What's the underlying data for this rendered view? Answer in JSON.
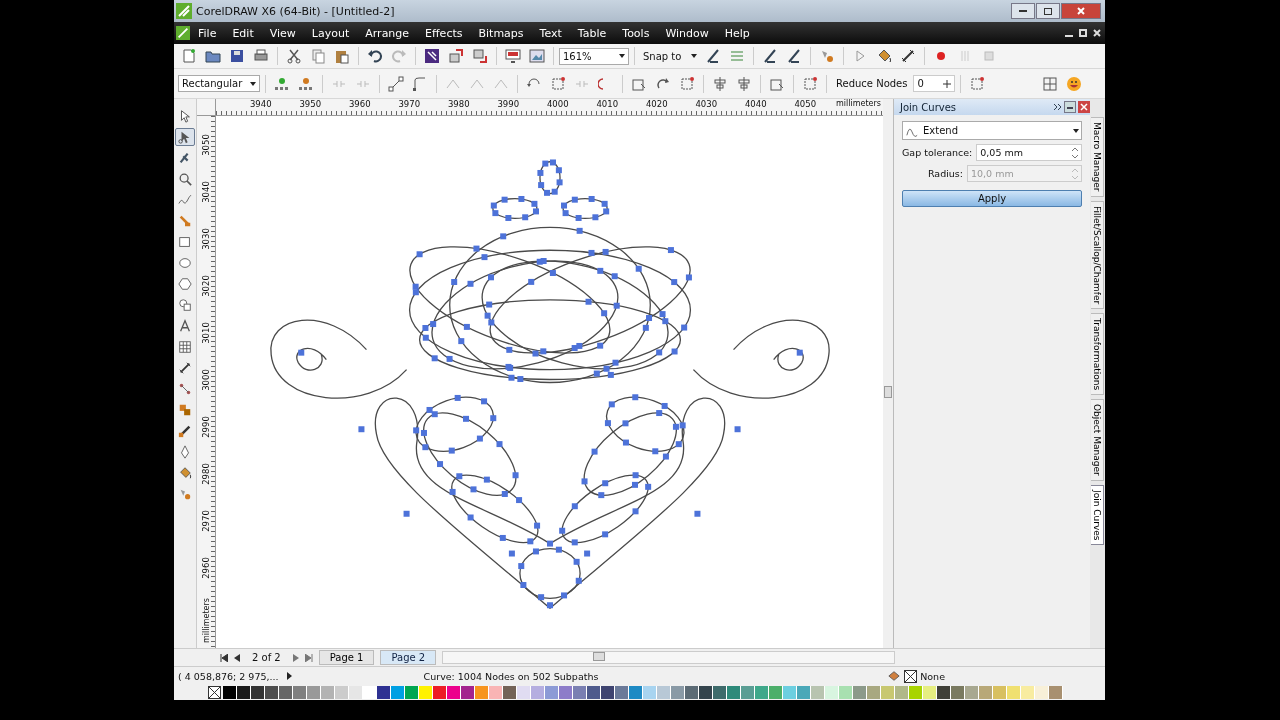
{
  "window": {
    "title": "CorelDRAW X6 (64-Bit) - [Untitled-2]"
  },
  "menu": [
    {
      "label": "File"
    },
    {
      "label": "Edit"
    },
    {
      "label": "View"
    },
    {
      "label": "Layout"
    },
    {
      "label": "Arrange"
    },
    {
      "label": "Effects"
    },
    {
      "label": "Bitmaps"
    },
    {
      "label": "Text"
    },
    {
      "label": "Table"
    },
    {
      "label": "Tools"
    },
    {
      "label": "Window"
    },
    {
      "label": "Help"
    }
  ],
  "standard_toolbar": {
    "zoom_level": "161%",
    "snap_to": "Snap to"
  },
  "property_bar": {
    "selection_mode": "Rectangular",
    "reduce_nodes_label": "Reduce Nodes",
    "reduce_nodes_value": "0"
  },
  "toolbox": [
    {
      "selected": false
    },
    {
      "selected": true
    },
    {
      "selected": false
    },
    {
      "selected": false
    },
    {
      "selected": false
    },
    {
      "selected": false
    },
    {
      "selected": false
    },
    {
      "selected": false
    },
    {
      "selected": false
    },
    {
      "selected": false
    },
    {
      "selected": false
    },
    {
      "selected": false
    },
    {
      "selected": false
    },
    {
      "selected": false
    },
    {
      "selected": false
    },
    {
      "selected": false
    },
    {
      "selected": false
    },
    {
      "selected": false
    },
    {
      "selected": false
    }
  ],
  "horizontal_ruler": {
    "ticks": [
      "3940",
      "3950",
      "3960",
      "3970",
      "3980",
      "3990",
      "4000",
      "4010",
      "4020",
      "4030",
      "4040",
      "4050"
    ],
    "unit": "millimeters"
  },
  "vertical_ruler": {
    "ticks": [
      "3050",
      "3040",
      "3030",
      "3020",
      "3010",
      "3000",
      "2990",
      "2980",
      "2970",
      "2960"
    ],
    "unit": "millimeters"
  },
  "docker": {
    "title": "Join Curves",
    "mode": "Extend",
    "gap_tolerance": {
      "label": "Gap tolerance:",
      "value": "0,05 mm"
    },
    "radius": {
      "label": "Radius:",
      "value": "10,0 mm",
      "disabled": true
    },
    "apply_button": "Apply"
  },
  "docker_tabs": [
    {
      "label": "Macro Manager",
      "selected": false
    },
    {
      "label": "Fillet/Scallop/Chamfer",
      "selected": false
    },
    {
      "label": "Transformations",
      "selected": false
    },
    {
      "label": "Object Manager",
      "selected": false
    },
    {
      "label": "Join Curves",
      "selected": true
    }
  ],
  "page_navigator": {
    "position": "2 of 2",
    "pages": [
      {
        "label": "Page 1",
        "selected": false
      },
      {
        "label": "Page 2",
        "selected": true
      }
    ]
  },
  "status_bar": {
    "coordinates": "( 4 058,876; 2 975,...",
    "selection_info": "Curve: 1004 Nodes on 502 Subpaths",
    "outline": "None"
  },
  "palette": [
    {
      "color": "#000000"
    },
    {
      "color": "#1a1a1a"
    },
    {
      "color": "#333333"
    },
    {
      "color": "#4d4d4d"
    },
    {
      "color": "#666666"
    },
    {
      "color": "#808080"
    },
    {
      "color": "#999999"
    },
    {
      "color": "#b3b3b3"
    },
    {
      "color": "#cccccc"
    },
    {
      "color": "#e6e6e6"
    },
    {
      "color": "#ffffff"
    },
    {
      "color": "#2e3192"
    },
    {
      "color": "#00a0e3"
    },
    {
      "color": "#00a651"
    },
    {
      "color": "#fff200"
    },
    {
      "color": "#ed1c24"
    },
    {
      "color": "#ec008c"
    },
    {
      "color": "#a3238e"
    },
    {
      "color": "#f7941d"
    },
    {
      "color": "#f9b4b4"
    },
    {
      "color": "#736357"
    },
    {
      "color": "#e0dcf2"
    },
    {
      "color": "#b5aee0"
    },
    {
      "color": "#8c9ad6"
    },
    {
      "color": "#8d7cc9"
    },
    {
      "color": "#7a7fb2"
    },
    {
      "color": "#4e5a8c"
    },
    {
      "color": "#3f4470"
    },
    {
      "color": "#6b7a99"
    },
    {
      "color": "#1e8ac4"
    },
    {
      "color": "#a8d4f0"
    },
    {
      "color": "#b8c8d6"
    },
    {
      "color": "#8a9aa6"
    },
    {
      "color": "#5c6b75"
    },
    {
      "color": "#34444d"
    },
    {
      "color": "#3e6b6b"
    },
    {
      "color": "#2e8a7a"
    },
    {
      "color": "#5a9e94"
    },
    {
      "color": "#3fa88a"
    },
    {
      "color": "#4caf6a"
    },
    {
      "color": "#6ccfe0"
    },
    {
      "color": "#4aa8b8"
    },
    {
      "color": "#b8c4b0"
    },
    {
      "color": "#d8f5e0"
    },
    {
      "color": "#a8e0b0"
    },
    {
      "color": "#8c9a8a"
    },
    {
      "color": "#a8a880"
    },
    {
      "color": "#c8c870"
    },
    {
      "color": "#b0b888"
    },
    {
      "color": "#a8d400"
    },
    {
      "color": "#e6ee80"
    },
    {
      "color": "#404038"
    },
    {
      "color": "#7a7a60"
    },
    {
      "color": "#a8a890"
    },
    {
      "color": "#b8a878"
    },
    {
      "color": "#d8c060"
    },
    {
      "color": "#f0e070"
    },
    {
      "color": "#f8eca0"
    },
    {
      "color": "#f8f0d8"
    },
    {
      "color": "#a89070"
    }
  ]
}
